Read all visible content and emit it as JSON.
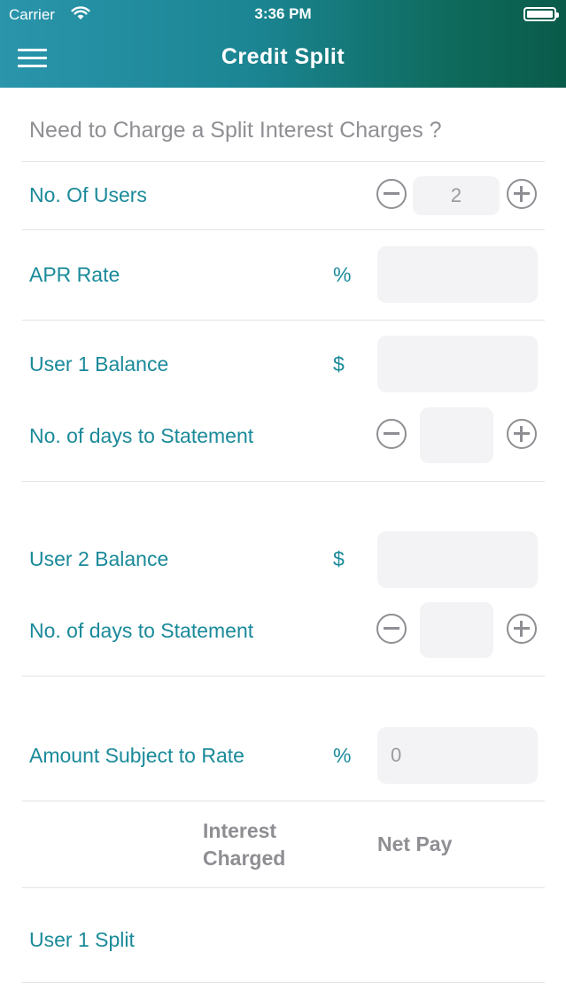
{
  "status": {
    "carrier": "Carrier",
    "time": "3:36 PM"
  },
  "nav": {
    "title": "Credit Split"
  },
  "subtitle": "Need to Charge a Split Interest Charges ?",
  "users": {
    "label": "No. Of Users",
    "value": "2"
  },
  "apr": {
    "label": "APR Rate",
    "unit": "%",
    "value": ""
  },
  "user1": {
    "balance_label": "User 1 Balance",
    "unit": "$",
    "balance_value": "",
    "days_label": "No. of days to Statement",
    "days_value": ""
  },
  "user2": {
    "balance_label": "User 2 Balance",
    "unit": "$",
    "balance_value": "",
    "days_label": "No. of days to Statement",
    "days_value": ""
  },
  "amount": {
    "label": "Amount Subject to Rate",
    "unit": "%",
    "placeholder": "0"
  },
  "results": {
    "col_interest_line1": "Interest",
    "col_interest_line2": "Charged",
    "col_net_pay": "Net Pay",
    "user1_split": "User 1 Split"
  },
  "icons": {
    "menu": "hamburger-menu-icon",
    "minus": "minus-circle-icon",
    "plus": "plus-circle-icon",
    "wifi": "wifi-icon",
    "battery": "battery-icon"
  },
  "colors": {
    "accent": "#1a8a9a",
    "header_start": "#2a95ab",
    "header_end": "#0a5b49",
    "field_bg": "#f3f3f5"
  }
}
